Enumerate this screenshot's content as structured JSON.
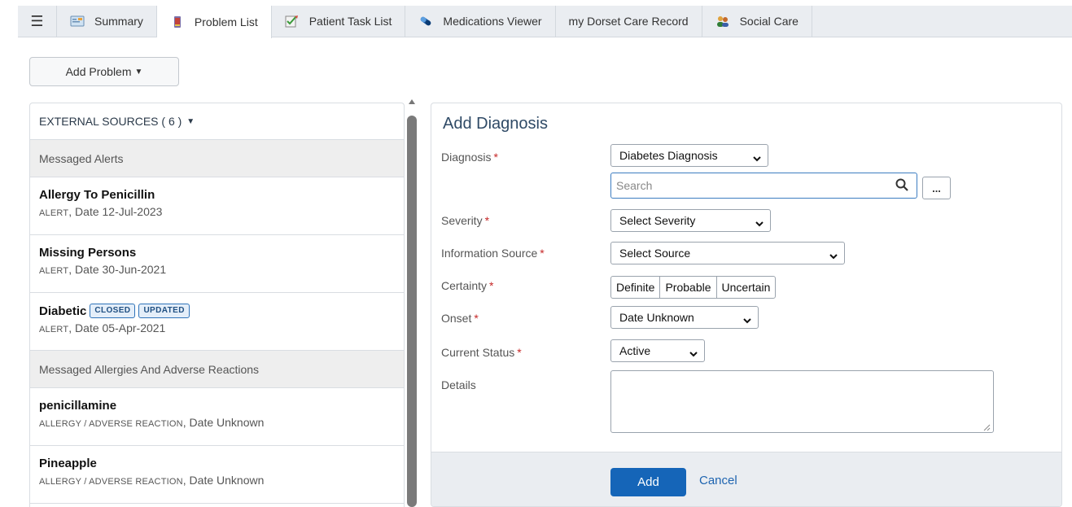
{
  "tabs": [
    {
      "label": "Summary",
      "icon": "summary-icon"
    },
    {
      "label": "Problem List",
      "icon": "problem-list-icon",
      "active": true
    },
    {
      "label": "Patient Task List",
      "icon": "task-list-icon"
    },
    {
      "label": "Medications Viewer",
      "icon": "pill-icon"
    },
    {
      "label": "my Dorset Care Record",
      "icon": null
    },
    {
      "label": "Social Care",
      "icon": "people-icon"
    }
  ],
  "toolbar": {
    "add_problem_label": "Add Problem"
  },
  "external_sources": {
    "header": "EXTERNAL SOURCES ( 6 )",
    "groups": [
      {
        "title": "Messaged Alerts",
        "entries": [
          {
            "name": "Allergy To Penicillin",
            "type": "ALERT",
            "detail": ", Date 12-Jul-2023",
            "badges": []
          },
          {
            "name": "Missing Persons",
            "type": "ALERT",
            "detail": ", Date 30-Jun-2021",
            "badges": []
          },
          {
            "name": "Diabetic",
            "type": "ALERT",
            "detail": ", Date 05-Apr-2021",
            "badges": [
              "CLOSED",
              "UPDATED"
            ]
          }
        ]
      },
      {
        "title": "Messaged Allergies And Adverse Reactions",
        "entries": [
          {
            "name": "penicillamine",
            "type": "ALLERGY / ADVERSE REACTION",
            "detail": ", Date Unknown",
            "badges": []
          },
          {
            "name": "Pineapple",
            "type": "ALLERGY / ADVERSE REACTION",
            "detail": ", Date Unknown",
            "badges": []
          }
        ]
      }
    ]
  },
  "form": {
    "title": "Add Diagnosis",
    "diagnosis_label": "Diagnosis",
    "diagnosis_value": "Diabetes Diagnosis",
    "search_placeholder": "Search",
    "more_label": "...",
    "severity_label": "Severity",
    "severity_value": "Select Severity",
    "source_label": "Information Source",
    "source_value": "Select Source",
    "certainty_label": "Certainty",
    "certainty_options": [
      "Definite",
      "Probable",
      "Uncertain"
    ],
    "onset_label": "Onset",
    "onset_value": "Date Unknown",
    "status_label": "Current Status",
    "status_value": "Active",
    "details_label": "Details",
    "required_marker": "*",
    "add_label": "Add",
    "cancel_label": "Cancel"
  },
  "colors": {
    "primary": "#1565b8",
    "required": "#c62828",
    "badge_border": "#2f73b9"
  }
}
